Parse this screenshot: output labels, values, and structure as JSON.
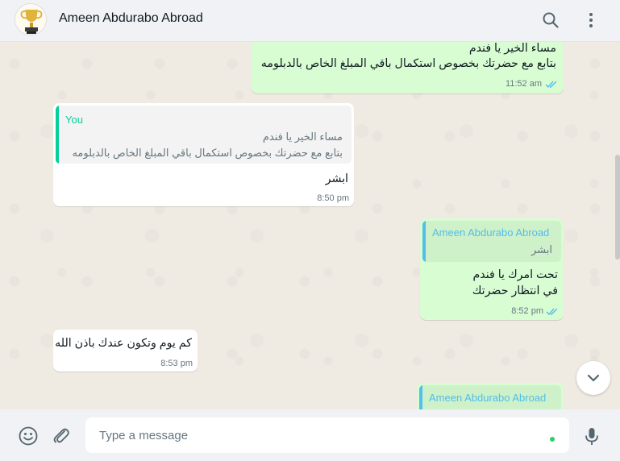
{
  "header": {
    "contact_name": "Ameen Abdurabo Abroad",
    "avatar_icon": "trophy-avatar-icon",
    "search_icon": "search-icon",
    "menu_icon": "kebab-menu-icon"
  },
  "messages": [
    {
      "direction": "outgoing",
      "lines": [
        "مساء الخير يا فندم",
        "بتابع مع حضرتك بخصوص استكمال باقي المبلغ الخاص بالدبلومه"
      ],
      "time": "11:52 am",
      "status": "read"
    },
    {
      "direction": "incoming",
      "quote": {
        "author": "You",
        "lines": [
          "مساء الخير يا فندم",
          "بتابع مع حضرتك بخصوص استكمال باقي المبلغ الخاص بالدبلومه"
        ]
      },
      "lines": [
        "ابشر"
      ],
      "time": "8:50 pm"
    },
    {
      "direction": "outgoing",
      "quote": {
        "author": "Ameen Abdurabo Abroad",
        "lines": [
          "ابشر"
        ]
      },
      "lines": [
        "تحت امرك يا فندم",
        "في انتظار حضرتك"
      ],
      "time": "8:52 pm",
      "status": "read"
    },
    {
      "direction": "incoming",
      "lines": [
        "كم يوم وتكون عندك باذن الله"
      ],
      "time": "8:53 pm"
    },
    {
      "direction": "outgoing",
      "quote": {
        "author": "Ameen Abdurabo Abroad",
        "lines": []
      },
      "lines": [],
      "time": ""
    }
  ],
  "footer": {
    "placeholder": "Type a message",
    "emoji_icon": "emoji-icon",
    "attach_icon": "paperclip-icon",
    "mic_icon": "microphone-icon"
  },
  "colors": {
    "outgoing_bubble": "#d9fdd3",
    "incoming_bubble": "#ffffff",
    "you_quote_accent": "#06cf9c",
    "contact_quote_accent": "#53bdeb",
    "read_ticks": "#53bdeb",
    "chat_background": "#efeae2"
  }
}
